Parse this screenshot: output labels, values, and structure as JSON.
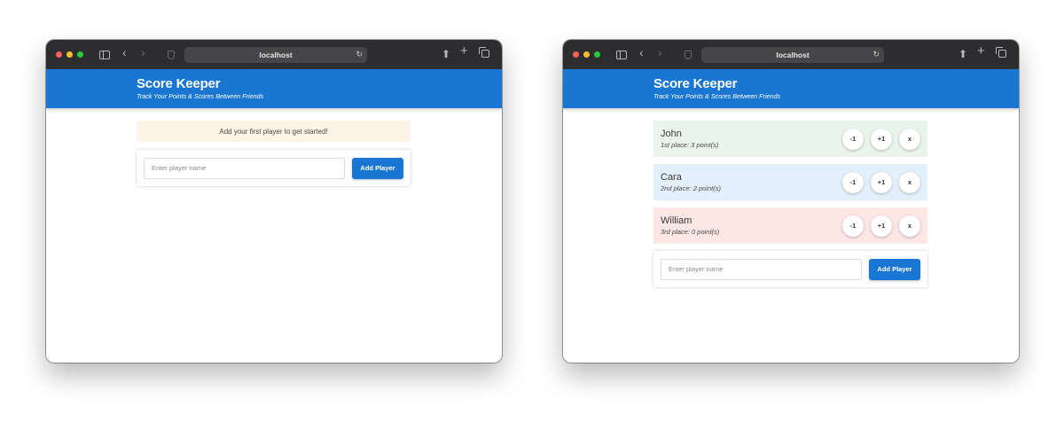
{
  "browser": {
    "url": "localhost"
  },
  "app": {
    "title": "Score Keeper",
    "subtitle": "Track Your Points & Scores Between Friends"
  },
  "empty_state": {
    "message": "Add your first player to get started!"
  },
  "add_player": {
    "placeholder": "Enter player name",
    "button_label": "Add Player"
  },
  "players": [
    {
      "name": "John",
      "summary": "1st place: 3 point(s)"
    },
    {
      "name": "Cara",
      "summary": "2nd place: 2 point(s)"
    },
    {
      "name": "William",
      "summary": "3rd place: 0 point(s)"
    }
  ],
  "controls": {
    "minus": "-1",
    "plus": "+1",
    "remove": "x"
  },
  "colors": {
    "brand": "#1976d2",
    "first_place_bg": "#e9f4ec",
    "second_place_bg": "#e3f0fb",
    "third_place_bg": "#fde7e5",
    "notice_bg": "#fdf3e6"
  }
}
